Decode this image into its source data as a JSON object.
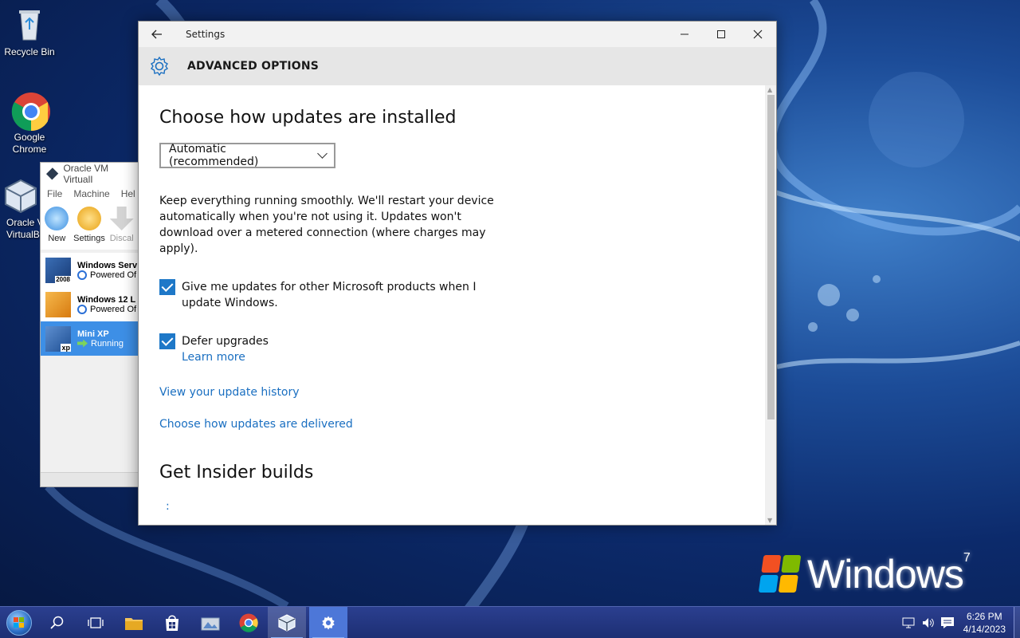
{
  "desktop": {
    "icons": [
      {
        "label": "Recycle Bin",
        "icon": "recycle-bin-icon"
      },
      {
        "label": "Google Chrome",
        "icon": "chrome-icon"
      },
      {
        "label": "Oracle VM VirtualBox",
        "label_visible": "Oracle V\nVirtualB",
        "icon": "virtualbox-icon"
      }
    ],
    "wallpaper_text": "Windows",
    "wallpaper_version": "7"
  },
  "virtualbox": {
    "title": "Oracle VM VirtualI",
    "menu": [
      "File",
      "Machine",
      "Hel"
    ],
    "toolbar": [
      {
        "label": "New",
        "icon": "new-vm-icon"
      },
      {
        "label": "Settings",
        "icon": "settings-gear-icon"
      },
      {
        "label": "Discal",
        "icon": "discard-icon"
      }
    ],
    "vms": [
      {
        "name": "Windows Serv",
        "state": "Powered Of",
        "badge": "2008",
        "selected": false
      },
      {
        "name": "Windows 12 L",
        "state": "Powered Of",
        "badge": "",
        "selected": false
      },
      {
        "name": "Mini XP",
        "state": "Running",
        "badge": "xp",
        "selected": true
      }
    ]
  },
  "settings": {
    "window_title": "Settings",
    "header": "ADVANCED OPTIONS",
    "section_title": "Choose how updates are installed",
    "dropdown_value": "Automatic (recommended)",
    "description": "Keep everything running smoothly. We'll restart your device automatically when you're not using it. Updates won't download over a metered connection (where charges may apply).",
    "checkbox_ms_products": {
      "label": "Give me updates for other Microsoft products when I update Windows.",
      "checked": true
    },
    "checkbox_defer": {
      "label": "Defer upgrades",
      "checked": true
    },
    "learn_more": "Learn more",
    "link_history": "View your update history",
    "link_delivery": "Choose how updates are delivered",
    "insider_title": "Get Insider builds",
    "loading_glyph": ":"
  },
  "taskbar": {
    "time": "6:26 PM",
    "date": "4/14/2023",
    "pinned": [
      "start-button",
      "search-icon",
      "task-view-icon",
      "file-explorer-icon",
      "store-icon",
      "photos-icon",
      "chrome-icon",
      "virtualbox-icon",
      "settings-icon"
    ]
  },
  "colors": {
    "accent": "#1e78c8",
    "link": "#1a6fc1",
    "taskbar": "#1d2f74",
    "vm_selected": "#3d8fe6"
  }
}
